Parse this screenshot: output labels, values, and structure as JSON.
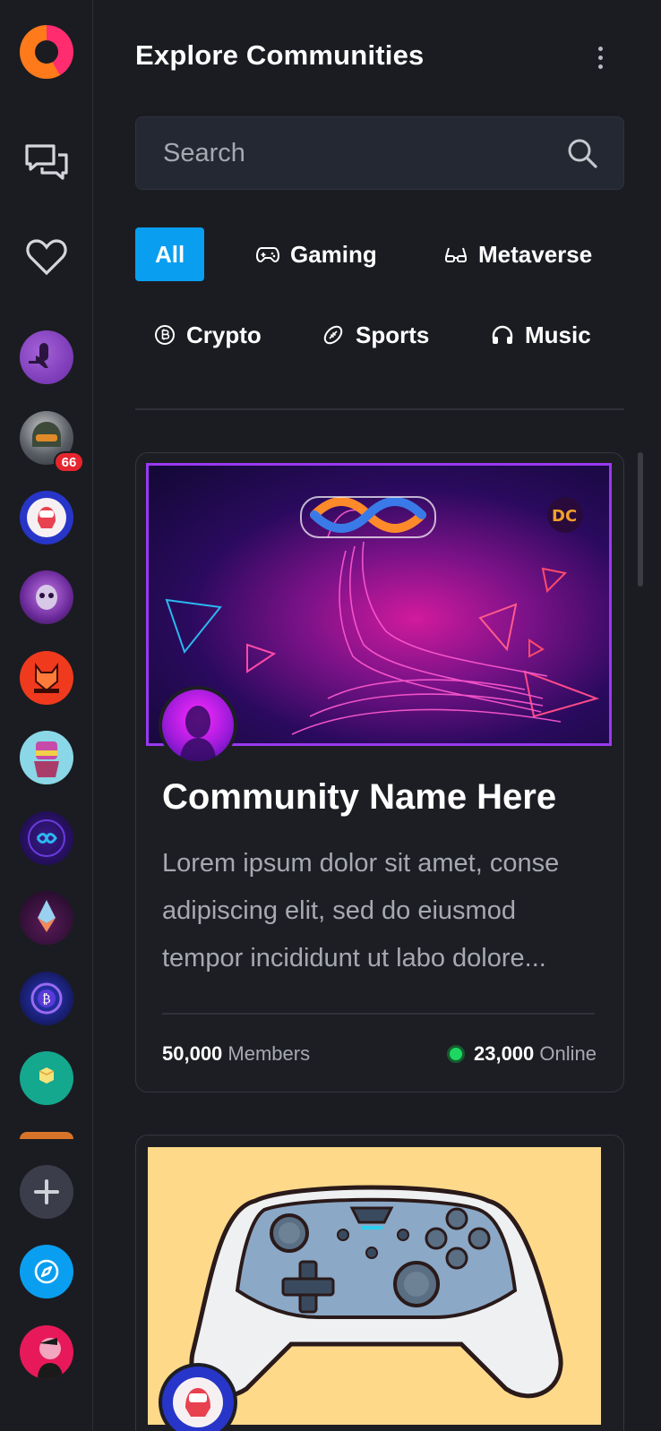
{
  "header": {
    "title": "Explore Communities"
  },
  "search": {
    "placeholder": "Search"
  },
  "filters": [
    {
      "label": "All",
      "icon": "none",
      "active": true
    },
    {
      "label": "Gaming",
      "icon": "gamepad-icon"
    },
    {
      "label": "Metaverse",
      "icon": "vr-glasses-icon"
    },
    {
      "label": "Crypto",
      "icon": "bitcoin-icon"
    },
    {
      "label": "Sports",
      "icon": "football-icon"
    },
    {
      "label": "Music",
      "icon": "headphones-icon"
    }
  ],
  "rail": {
    "badge_count": "66"
  },
  "cards": [
    {
      "title": "Community Name Here",
      "description": "Lorem ipsum dolor sit amet, conse adipiscing elit, sed do eiusmod tempor incididunt ut labo dolore...",
      "members_count": "50,000",
      "members_label": "Members",
      "online_count": "23,000",
      "online_label": "Online"
    }
  ],
  "colors": {
    "accent": "#0a9ef0",
    "background": "#1b1c21",
    "online": "#1ed760",
    "badge": "#e5262f",
    "highlight_border": "#9a39f0"
  }
}
